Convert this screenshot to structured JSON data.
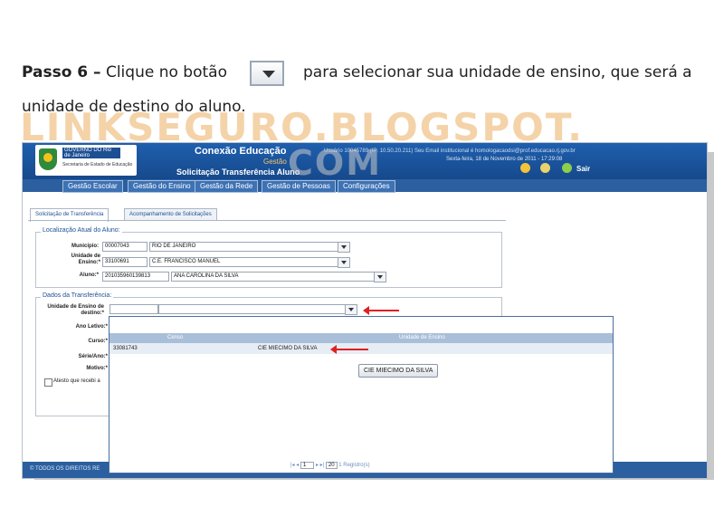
{
  "instruction": {
    "step_label": "Passo 6 –",
    "line1_before": "Clique no botão",
    "line1_after": "para selecionar sua unidade de ensino, que será a",
    "line2": "unidade de destino do aluno."
  },
  "watermark": {
    "line1": "LINKSEGURO.BLOGSPOT.",
    "line2": "COM"
  },
  "header": {
    "logo_name": "GOVERNO DO Rio de Janeiro",
    "logo_sub": "Secretaria de Estado de Educação",
    "app_title": "Conexão Educação",
    "app_module": "Gestão",
    "subtitle": "Solicitação Transferência Aluno",
    "user_info": "Usuário 10045789 (IP: 10.50.20.211) Seu Email institucional é homologacaodsi@prof.educacao.rj.gov.br",
    "date": "Sexta-feira, 18 de Novembro de 2011 - 17:29:08",
    "sair": "Sair"
  },
  "menu": [
    "Gestão Escolar",
    "Gestão do Ensino",
    "Gestão da Rede",
    "Gestão de Pessoas",
    "Configurações"
  ],
  "tabs": [
    "Solicitação de Transferência",
    "Acompanhamento de Solicitações"
  ],
  "localizacao": {
    "legend": "Localização Atual do Aluno:",
    "municipio_label": "Município:",
    "municipio_code": "00007043",
    "municipio_name": "RIO DE JANEIRO",
    "unidade_label": "Unidade de Ensino:*",
    "unidade_code": "33100691",
    "unidade_name": "C.E. FRANCISCO MANUEL",
    "aluno_label": "Aluno:*",
    "aluno_code": "201035960139813",
    "aluno_name": "ANA CAROLINA DA SILVA"
  },
  "transferencia": {
    "legend": "Dados da Transferência:",
    "unidade_label": "Unidade de Ensino de destino:*",
    "ano_label": "Ano Letivo:*",
    "curso_label": "Curso:*",
    "serie_label": "Série/Ano:*",
    "motivo_label": "Motivo:*",
    "atesto_label": "Atesto que recebi a"
  },
  "popup": {
    "col_censo": "Censo",
    "col_unidade": "Unidade de Ensino",
    "row_censo": "33081743",
    "row_unidade": "CIE MIECIMO DA SILVA",
    "select_button": "CIE MIECIMO DA SILVA",
    "pager_page": "1",
    "pager_size": "20",
    "pager_info": "1 Registro(s)"
  },
  "footer": {
    "text": "© TODOS OS DIREITOS RE"
  },
  "colors": {
    "header_blue": "#1f5fae",
    "arrow_red": "#e02020",
    "watermark": "#f0c48c"
  }
}
